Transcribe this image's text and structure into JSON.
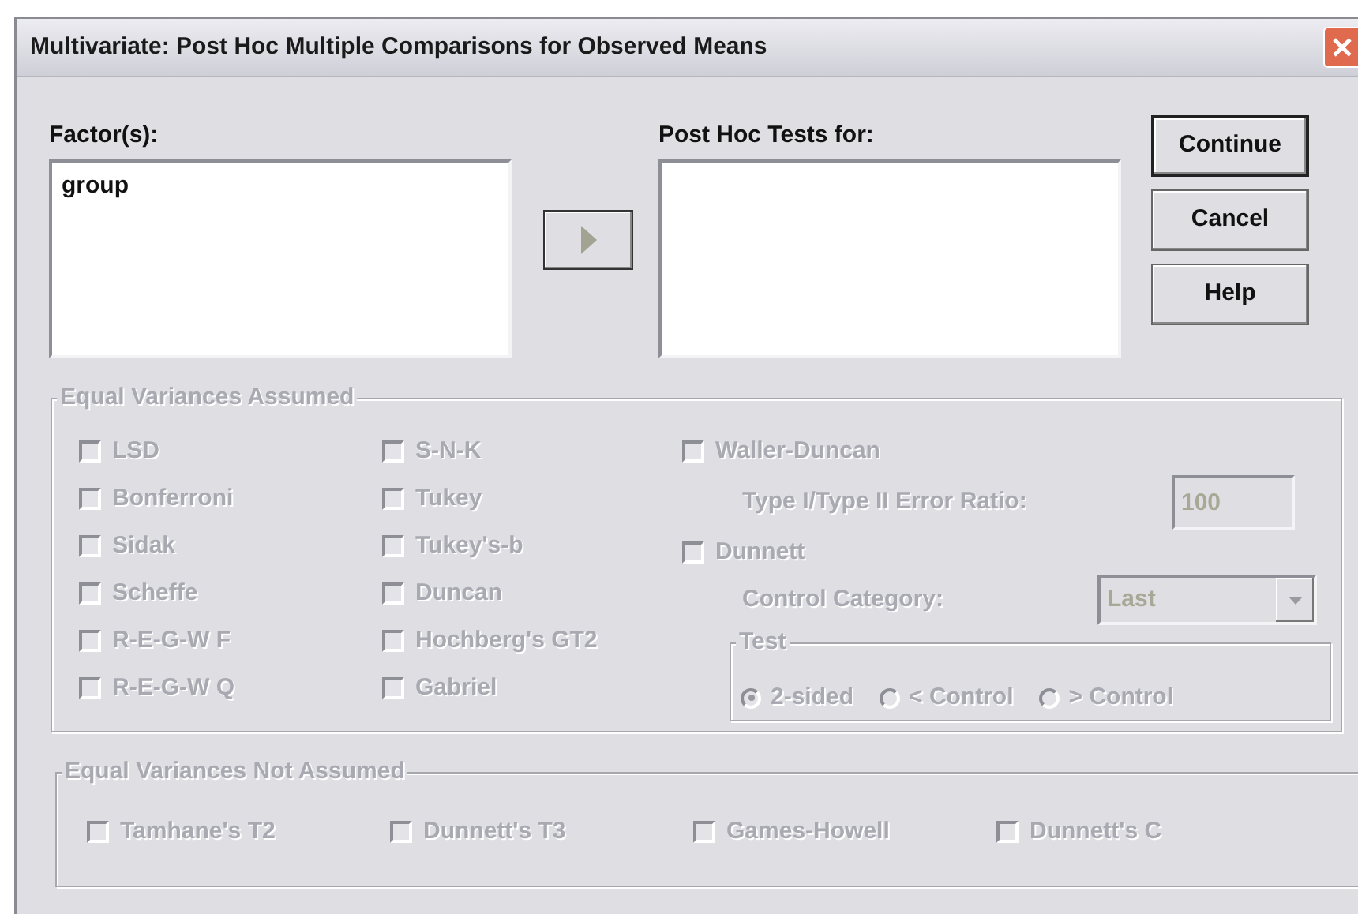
{
  "window": {
    "title": "Multivariate: Post Hoc Multiple Comparisons for Observed Means"
  },
  "factors": {
    "label": "Factor(s):",
    "items": [
      {
        "label": "group"
      }
    ]
  },
  "move_button": {
    "disabled": true
  },
  "post_hoc_tests": {
    "label": "Post Hoc Tests for:"
  },
  "buttons": [
    {
      "label": "Continue",
      "default": true
    },
    {
      "label": "Cancel",
      "default": false
    },
    {
      "label": "Help",
      "default": false
    }
  ],
  "equal_variances_assumed": {
    "title": "Equal Variances Assumed",
    "disabled": true,
    "columns": [
      [
        {
          "label": "LSD",
          "checked": false
        },
        {
          "label": "Bonferroni",
          "checked": false
        },
        {
          "label": "Sidak",
          "checked": false
        },
        {
          "label": "Scheffe",
          "checked": false
        },
        {
          "label": "R-E-G-W F",
          "checked": false
        },
        {
          "label": "R-E-G-W Q",
          "checked": false
        }
      ],
      [
        {
          "label": "S-N-K",
          "checked": false
        },
        {
          "label": "Tukey",
          "checked": false
        },
        {
          "label": "Tukey's-b",
          "checked": false
        },
        {
          "label": "Duncan",
          "checked": false
        },
        {
          "label": "Hochberg's GT2",
          "checked": false
        },
        {
          "label": "Gabriel",
          "checked": false
        }
      ]
    ],
    "waller_duncan": {
      "label": "Waller-Duncan",
      "checked": false
    },
    "error_ratio": {
      "label": "Type I/Type II Error Ratio:",
      "value": "100"
    },
    "dunnett": {
      "label": "Dunnett",
      "checked": false
    },
    "control_category": {
      "label": "Control Category:",
      "value": "Last"
    },
    "test": {
      "title": "Test",
      "options": [
        {
          "label": "2-sided",
          "selected": true
        },
        {
          "label": "< Control",
          "selected": false
        },
        {
          "label": "> Control",
          "selected": false
        }
      ]
    }
  },
  "equal_variances_not_assumed": {
    "title": "Equal Variances Not Assumed",
    "disabled": true,
    "items": [
      {
        "label": "Tamhane's T2",
        "checked": false
      },
      {
        "label": "Dunnett's T3",
        "checked": false
      },
      {
        "label": "Games-Howell",
        "checked": false
      },
      {
        "label": "Dunnett's C",
        "checked": false
      }
    ]
  }
}
